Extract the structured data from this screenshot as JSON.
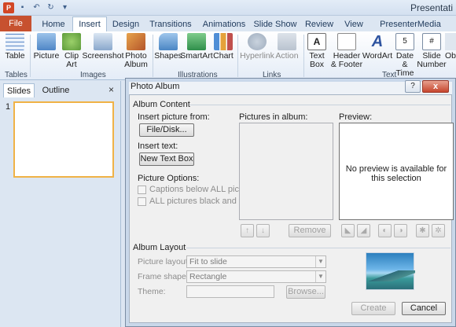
{
  "app": {
    "title": "Presentati"
  },
  "qat": [
    {
      "icon": "undo-icon",
      "glyph": "↶"
    },
    {
      "icon": "redo-icon",
      "glyph": "↻"
    },
    {
      "icon": "customize-icon",
      "glyph": "▾"
    }
  ],
  "tabs": [
    {
      "label": "File"
    },
    {
      "label": "Home"
    },
    {
      "label": "Insert"
    },
    {
      "label": "Design"
    },
    {
      "label": "Transitions"
    },
    {
      "label": "Animations"
    },
    {
      "label": "Slide Show"
    },
    {
      "label": "Review"
    },
    {
      "label": "View"
    },
    {
      "label": "PresenterMedia"
    }
  ],
  "ribbon": {
    "buttons": [
      {
        "line1": "Table",
        "line2": "",
        "color": "#5a88c8"
      },
      {
        "line1": "Picture",
        "line2": "",
        "color": "#6fa0d8"
      },
      {
        "line1": "Clip",
        "line2": "Art",
        "color": "#8dbb5c"
      },
      {
        "line1": "Screenshot",
        "line2": "",
        "color": "#7fa2c9"
      },
      {
        "line1": "Photo",
        "line2": "Album",
        "color": "#d8893c"
      },
      {
        "line1": "Shapes",
        "line2": "",
        "color": "#6aa6da"
      },
      {
        "line1": "SmartArt",
        "line2": "",
        "color": "#4fa86a"
      },
      {
        "line1": "Chart",
        "line2": "",
        "color": "#e5a23a"
      },
      {
        "line1": "Hyperlink",
        "line2": "",
        "color": "#b8c4d2"
      },
      {
        "line1": "Action",
        "line2": "",
        "color": "#c2cad6"
      },
      {
        "line1": "Text",
        "line2": "Box",
        "color": "#e8edf4"
      },
      {
        "line1": "Header",
        "line2": "& Footer",
        "color": "#dfe6ef"
      },
      {
        "line1": "WordArt",
        "line2": "",
        "color": "#3c5fa0"
      },
      {
        "line1": "Date",
        "line2": "& Time",
        "color": "#9ab2d0"
      },
      {
        "line1": "Slide",
        "line2": "Number",
        "color": "#c9d5e4"
      },
      {
        "line1": "Ob",
        "line2": "",
        "color": "#dfe6ef"
      }
    ],
    "groups": [
      "Tables",
      "Images",
      "Illustrations",
      "Links",
      "Text"
    ]
  },
  "leftpane": {
    "tabs": [
      "Slides",
      "Outline"
    ],
    "close": "×",
    "slide_number": "1"
  },
  "dialog": {
    "title": "Photo Album",
    "help": "?",
    "close": "x",
    "album_content": "Album Content",
    "insert_picture_from": "Insert picture from:",
    "file_disk": "File/Disk...",
    "insert_text": "Insert text:",
    "new_text_box": "New Text Box",
    "picture_options": "Picture Options:",
    "captions_below": "Captions below ALL pictures",
    "all_black_white": "ALL pictures black and white",
    "pictures_in_album": "Pictures in album:",
    "preview": "Preview:",
    "preview_text": "No preview is available for this selection",
    "move_up": "↑",
    "move_down": "↓",
    "remove": "Remove",
    "album_layout": "Album Layout",
    "picture_layout_label": "Picture layout:",
    "picture_layout_value": "Fit to slide",
    "frame_shape_label": "Frame shape:",
    "frame_shape_value": "Rectangle",
    "theme_label": "Theme:",
    "browse": "Browse...",
    "create": "Create",
    "cancel": "Cancel"
  }
}
